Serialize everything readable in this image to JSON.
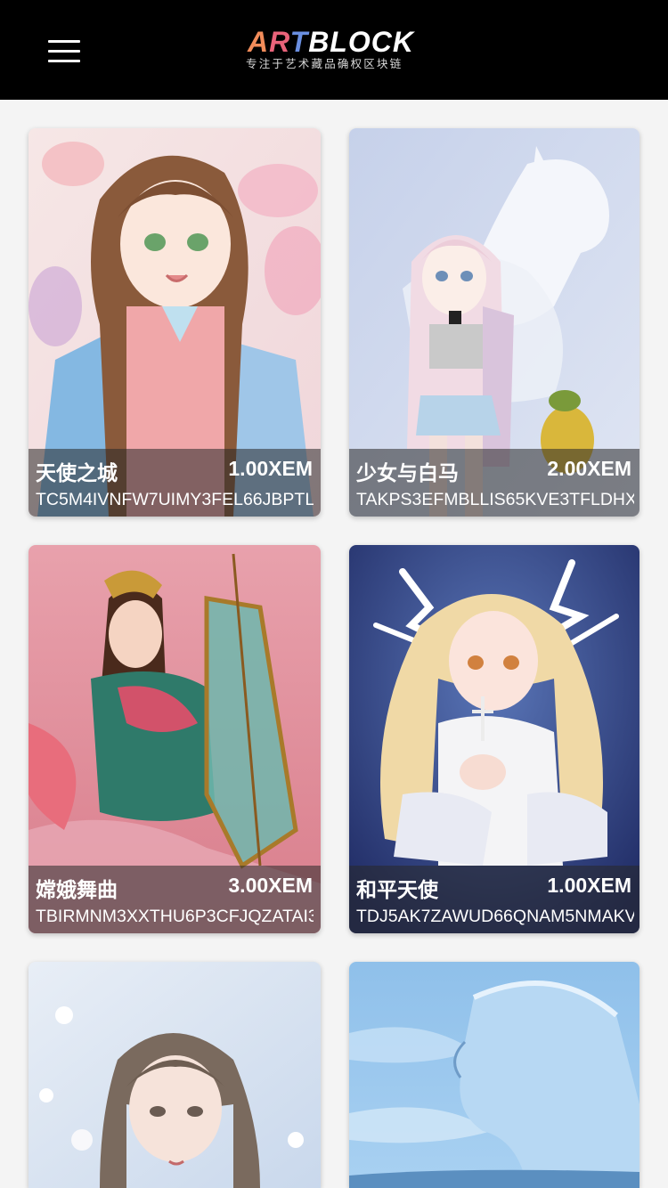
{
  "header": {
    "menu_icon": "hamburger-menu-icon",
    "logo": {
      "word_a": "A",
      "word_r": "R",
      "word_t": "T",
      "word_rest": "BLOCK",
      "tagline": "专注于艺术藏品确权区块链"
    },
    "colors": {
      "background": "#000000",
      "logo_a": "#f28c5a",
      "logo_r": "#e9637a",
      "logo_t": "#6a8fe0"
    }
  },
  "artworks": [
    {
      "title": "天使之城",
      "price": "1.00XEM",
      "address": "TC5M4IVNFW7UIMY3FEL66JBPTL"
    },
    {
      "title": "少女与白马",
      "price": "2.00XEM",
      "address": "TAKPS3EFMBLLIS65KVE3TFLDHX"
    },
    {
      "title": "嫦娥舞曲",
      "price": "3.00XEM",
      "address": "TBIRMNM3XXTHU6P3CFJQZATAI3"
    },
    {
      "title": "和平天使",
      "price": "1.00XEM",
      "address": "TDJ5AK7ZAWUD66QNAM5NMAKV"
    },
    {
      "title": "",
      "price": "",
      "address": ""
    },
    {
      "title": "",
      "price": "",
      "address": ""
    }
  ]
}
